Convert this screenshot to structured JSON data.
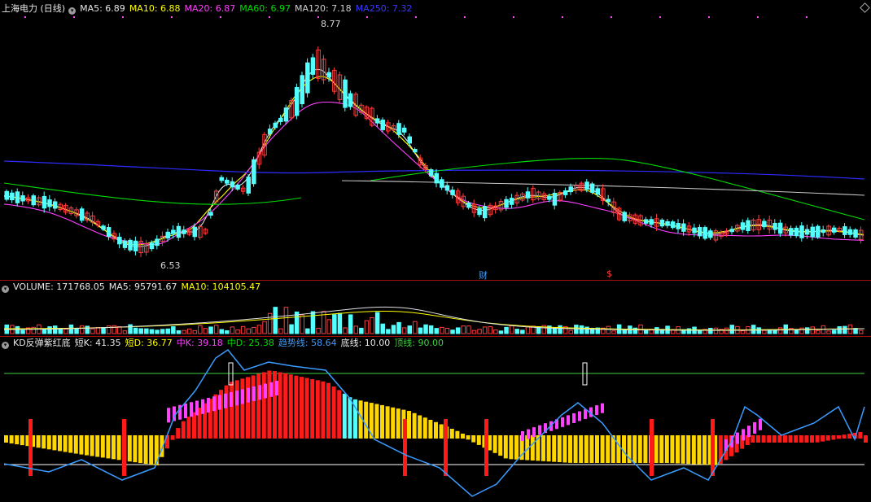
{
  "main_header": {
    "stock_name": "上海电力 (日线)",
    "ma5": "MA5: 6.89",
    "ma10": "MA10: 6.88",
    "ma20": "MA20: 6.87",
    "ma60": "MA60: 6.97",
    "ma120": "MA120: 7.18",
    "ma250": "MA250: 7.32"
  },
  "price_labels": {
    "high": "8.77",
    "low": "6.53"
  },
  "event_markers": {
    "finance": "财",
    "dividend": "$"
  },
  "volume_header": {
    "volume": "VOLUME: 171768.05",
    "ma5": "MA5: 95791.67",
    "ma10": "MA10: 104105.47"
  },
  "indicator_header": {
    "name": "KD反弹紫红底",
    "short_k": "短K: 41.35",
    "short_d": "短D: 36.77",
    "mid_k": "中K: 39.18",
    "mid_d": "中D: 25.38",
    "trend": "趋势线: 58.64",
    "bottom": "底线: 10.00",
    "top": "顶线: 90.00"
  },
  "colors": {
    "ma5": "#e6e6e6",
    "ma10": "#ffff00",
    "ma20": "#ff40ff",
    "ma60": "#00dd00",
    "ma120": "#c8c8c8",
    "ma250": "#2c2cff",
    "up": "#ff3c3c",
    "down": "#54ffff",
    "trend_line": "#3a9cff",
    "bottom_line": "#ffffff",
    "top_line": "#3cd23c"
  }
}
